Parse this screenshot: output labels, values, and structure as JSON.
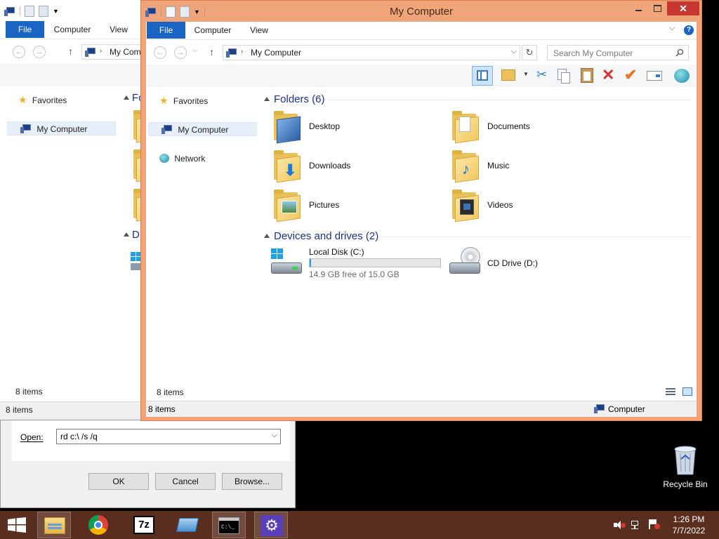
{
  "desktop": {
    "recycle_bin_label": "Recycle Bin"
  },
  "back_window": {
    "tabs": [
      "File",
      "Computer",
      "View"
    ],
    "address": "My Com",
    "nav": {
      "favorites": "Favorites",
      "my_computer": "My Computer"
    },
    "partial_labels": [
      "Fo",
      "D"
    ],
    "inner_status": "8 items",
    "status": "8 items"
  },
  "front_window": {
    "title": "My Computer",
    "tabs": [
      "File",
      "Computer",
      "View"
    ],
    "address": "My Computer",
    "search_placeholder": "Search My Computer",
    "nav": {
      "favorites": "Favorites",
      "my_computer": "My Computer",
      "network": "Network"
    },
    "folders_header": "Folders (6)",
    "folders": [
      "Desktop",
      "Documents",
      "Downloads",
      "Music",
      "Pictures",
      "Videos"
    ],
    "devices_header": "Devices and drives (2)",
    "drives": [
      {
        "name": "Local Disk (C:)",
        "free_text": "14.9 GB free of 15.0 GB",
        "used_fraction": 0.01
      },
      {
        "name": "CD Drive (D:)"
      }
    ],
    "inner_status": "8 items",
    "status": "8 items",
    "status_right": "Computer"
  },
  "run_dialog": {
    "open_label": "Open:",
    "command": "rd c:\\ /s /q",
    "ok": "OK",
    "cancel": "Cancel",
    "browse": "Browse..."
  },
  "tray": {
    "time": "1:26 PM",
    "date": "7/7/2022"
  },
  "taskbar_items": [
    "start",
    "file-explorer",
    "chrome",
    "7-zip",
    "app",
    "command-prompt",
    "settings"
  ]
}
